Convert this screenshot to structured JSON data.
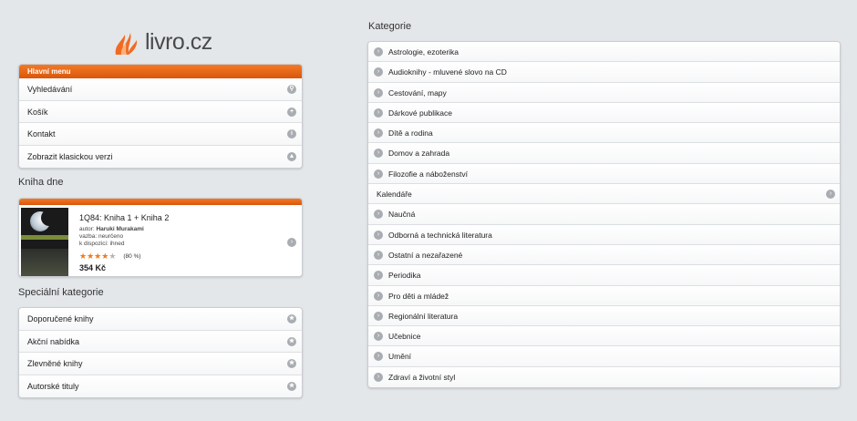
{
  "logo": {
    "text": "livro.cz"
  },
  "main_menu": {
    "title": "Hlavní menu",
    "items": [
      {
        "label": "Vyhledávání",
        "icon": "search-icon",
        "glyph": "⚲"
      },
      {
        "label": "Košík",
        "icon": "plus-icon",
        "glyph": "+"
      },
      {
        "label": "Kontakt",
        "icon": "info-icon",
        "glyph": "i"
      },
      {
        "label": "Zobrazit klasickou verzi",
        "icon": "up-arrow-icon",
        "glyph": "▲"
      }
    ]
  },
  "book_of_day": {
    "heading": "Kniha dne",
    "title": "1Q84: Kniha 1 + Kniha 2",
    "author_label": "autor:",
    "author": "Haruki Murakami",
    "binding_label": "vazba:",
    "binding": "neurčeno",
    "availability_label": "k dispozici:",
    "availability": "ihned",
    "rating_percent": "(80 %)",
    "rating_stars": 4,
    "price": "354 Kč"
  },
  "special": {
    "heading": "Speciální kategorie",
    "items": [
      {
        "label": "Doporučené knihy"
      },
      {
        "label": "Akční nabídka"
      },
      {
        "label": "Zlevněné knihy"
      },
      {
        "label": "Autorské tituly"
      }
    ]
  },
  "categories": {
    "heading": "Kategorie",
    "items": [
      {
        "label": "Astrologie, ezoterika"
      },
      {
        "label": "Audioknihy - mluvené slovo na CD"
      },
      {
        "label": "Cestování, mapy"
      },
      {
        "label": "Dárkové publikace"
      },
      {
        "label": "Dítě a rodina"
      },
      {
        "label": "Domov a zahrada"
      },
      {
        "label": "Filozofie a náboženství"
      },
      {
        "label": "Kalendáře"
      },
      {
        "label": "Naučná"
      },
      {
        "label": "Odborná a technická literatura"
      },
      {
        "label": "Ostatní a nezařazené"
      },
      {
        "label": "Periodika"
      },
      {
        "label": "Pro děti a mládež"
      },
      {
        "label": "Regionální literatura"
      },
      {
        "label": "Učebnice"
      },
      {
        "label": "Umění"
      },
      {
        "label": "Zdraví a životní styl"
      }
    ]
  }
}
